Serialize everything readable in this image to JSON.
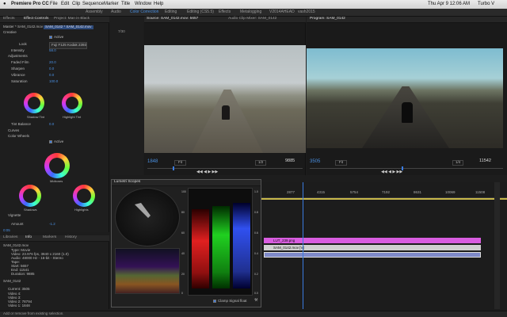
{
  "menubar": {
    "apple": "",
    "app": "Premiere Pro CC",
    "items": [
      "File",
      "Edit",
      "Clip",
      "Sequence",
      "Marker",
      "Title",
      "Window",
      "Help"
    ],
    "clock": "Thu Apr 9  12:06 AM",
    "user": "Turbo V"
  },
  "workspaces": [
    "Assembly",
    "Audio",
    "Color Correction",
    "Editing",
    "Editing (CS5.5)",
    "Effects",
    "Metalogging",
    "V2014AHEAD",
    "vash2015"
  ],
  "active_workspace": "Color Correction",
  "effect_controls": {
    "tabs": [
      "Effects",
      "Effect Controls",
      "Project: Man in Black"
    ],
    "master": "Master * SAM_0142.mov",
    "clip": "SAM_0142 * SAM_0142.mov",
    "timecode": "7/30",
    "creative_label": "Creative",
    "active_label": "Active",
    "look_label": "Look",
    "look_value": "Fuji F125 Kodak 2393",
    "intensity_label": "Intensity",
    "intensity_value": "58.0",
    "adjustments_label": "Adjustments",
    "rows": [
      {
        "label": "Faded Film",
        "value": "20.0"
      },
      {
        "label": "Sharpen",
        "value": "0.0"
      },
      {
        "label": "Vibrance",
        "value": "0.0"
      },
      {
        "label": "Saturation",
        "value": "100.0"
      }
    ],
    "shadow_tint": "Shadow Tint",
    "highlight_tint": "Highlight Tint",
    "tint_balance_label": "Tint Balance",
    "tint_balance_value": "0.0",
    "curves_label": "Curves",
    "color_wheels_label": "Color Wheels",
    "midtones": "Midtones",
    "shadows": "Shadows",
    "highlights": "Highlights",
    "vignette_label": "Vignette",
    "amount_label": "Amount",
    "amount_value": "-1.2",
    "bottom_tc": "0:05"
  },
  "info_panel": {
    "tabs": [
      "Libraries",
      "Info",
      "Markers",
      "History"
    ],
    "clip_name": "SAM_0142.mov",
    "lines": [
      "Type: Movie",
      "Video: 23.976 fps, 3840 x 2160 (1.0)",
      "Audio: 48000 Hz - 16-bit - Stereo",
      "Tape:",
      "Start: 5657",
      "End: 11541",
      "Duration: 9885"
    ],
    "seq": "SAM_0142",
    "current": "Current: 3505",
    "tracks": [
      "Video 4:",
      "Video 3:",
      "Video 2: 78794",
      "Video 1: 1848"
    ]
  },
  "source": {
    "tabs": [
      "Source: SAM_0142.mov: 5657",
      "Audio Clip Mixer: SAM_0142"
    ],
    "tc_left": "1848",
    "fit": "Fit",
    "ratio": "1/2",
    "tc_right": "9885"
  },
  "program": {
    "tab": "Program: SAM_0142",
    "tc_left": "3505",
    "fit": "Fit",
    "ratio": "1/4",
    "tc_right": "11542"
  },
  "scopes": {
    "title": "Lumetri Scopes",
    "clamp": "Clamp Signal",
    "float": "float",
    "ticks_left": [
      "100",
      "80",
      "60",
      "40",
      "20",
      "0"
    ],
    "ticks_right": [
      "1.0",
      "0.8",
      "0.6",
      "0.4",
      "0.2",
      "0.0"
    ]
  },
  "timeline": {
    "ruler": [
      "2877",
      "4315",
      "5754",
      "7192",
      "8631",
      "10069",
      "11508"
    ],
    "clips": [
      {
        "label": "LUT_239.png",
        "color": "#d95de0"
      },
      {
        "label": "SAM_0142.mov [V]",
        "color": "#d0d0d0"
      },
      {
        "label": "",
        "color": "#7e89c9"
      }
    ]
  },
  "status": "Click to select, or click in empty space and drag to marquee select. Use Shift, Opt, and Cmd for other options.",
  "status_short": "Add or remove from existing selection.",
  "colors": {
    "accent": "#4a90e2",
    "timeline_playhead": "#3a7be0"
  }
}
